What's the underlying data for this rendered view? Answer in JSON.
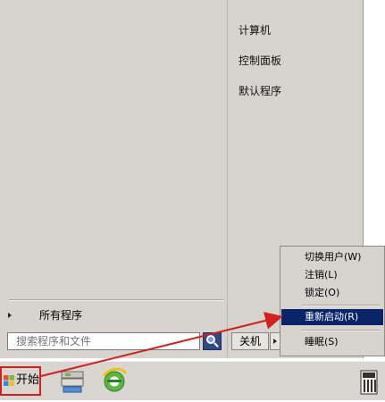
{
  "start_menu": {
    "right_items": [
      "计算机",
      "控制面板",
      "默认程序"
    ],
    "all_programs": "所有程序",
    "search": {
      "placeholder": "搜索程序和文件"
    },
    "shutdown": {
      "label": "关机"
    }
  },
  "power_menu": {
    "items": [
      {
        "label": "切换用户(W)"
      },
      {
        "label": "注销(L)"
      },
      {
        "label": "锁定(O)"
      },
      {
        "label": "重新启动(R)"
      },
      {
        "label": "睡眠(S)"
      }
    ],
    "selected_index": 3
  },
  "taskbar": {
    "start_label": "开始"
  },
  "annotation": {
    "color": "#d41f1f"
  },
  "colors": {
    "menu_bg": "#d7d4cf",
    "selection_bg": "#0a246a",
    "selection_text": "#ffffff"
  }
}
